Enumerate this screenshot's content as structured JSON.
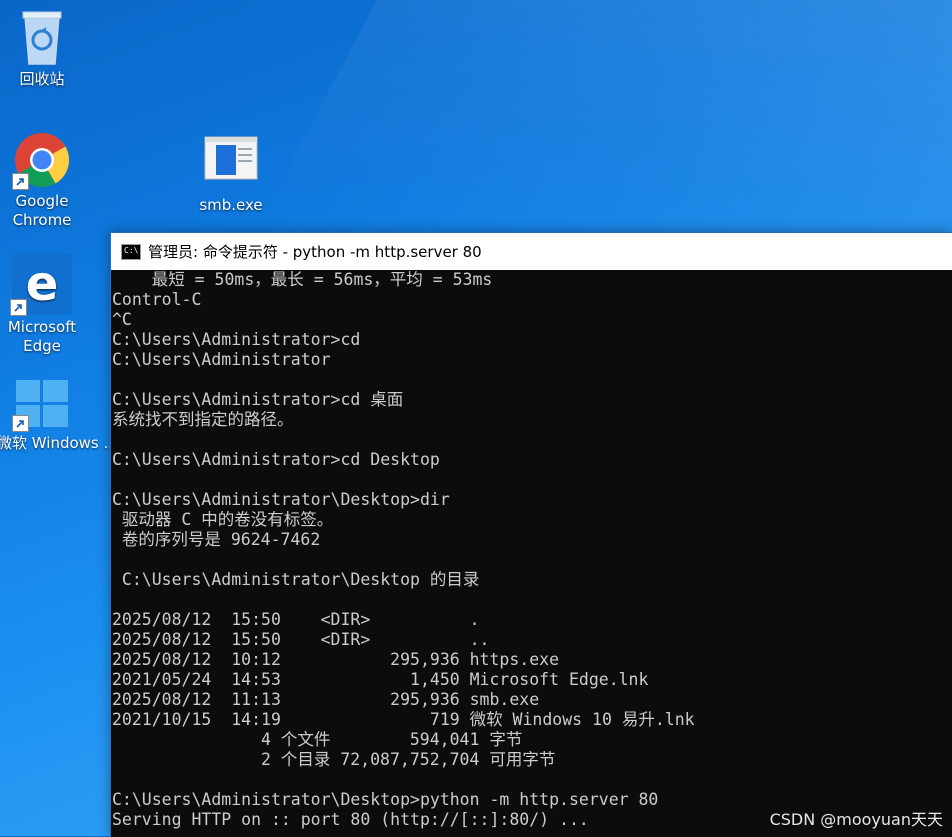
{
  "desktop": {
    "icons": [
      {
        "name": "recycle-bin",
        "label": "回收站"
      },
      {
        "name": "google-chrome",
        "label": "Google Chrome"
      },
      {
        "name": "smb-exe",
        "label": "smb.exe"
      },
      {
        "name": "microsoft-edge",
        "label": "Microsoft Edge"
      },
      {
        "name": "windows-upgrade",
        "label": "微软 Windows ..."
      }
    ]
  },
  "console": {
    "title": "管理员: 命令提示符 - python  -m http.server 80",
    "lines": [
      "    最短 = 50ms，最长 = 56ms，平均 = 53ms",
      "Control-C",
      "^C",
      "C:\\Users\\Administrator>cd",
      "C:\\Users\\Administrator",
      "",
      "C:\\Users\\Administrator>cd 桌面",
      "系统找不到指定的路径。",
      "",
      "C:\\Users\\Administrator>cd Desktop",
      "",
      "C:\\Users\\Administrator\\Desktop>dir",
      " 驱动器 C 中的卷没有标签。",
      " 卷的序列号是 9624-7462",
      "",
      " C:\\Users\\Administrator\\Desktop 的目录",
      "",
      "2025/08/12  15:50    <DIR>          .",
      "2025/08/12  15:50    <DIR>          ..",
      "2025/08/12  10:12           295,936 https.exe",
      "2021/05/24  14:53             1,450 Microsoft Edge.lnk",
      "2025/08/12  11:13           295,936 smb.exe",
      "2021/10/15  14:19               719 微软 Windows 10 易升.lnk",
      "               4 个文件        594,041 字节",
      "               2 个目录 72,087,752,704 可用字节",
      "",
      "C:\\Users\\Administrator\\Desktop>python -m http.server 80",
      "Serving HTTP on :: port 80 (http://[::]:80/) ..."
    ]
  },
  "watermark": "CSDN @mooyuan天天",
  "colors": {
    "console_bg": "#0c0c0c",
    "console_text": "#cccccc",
    "desktop_blue": "#0f7be0"
  }
}
